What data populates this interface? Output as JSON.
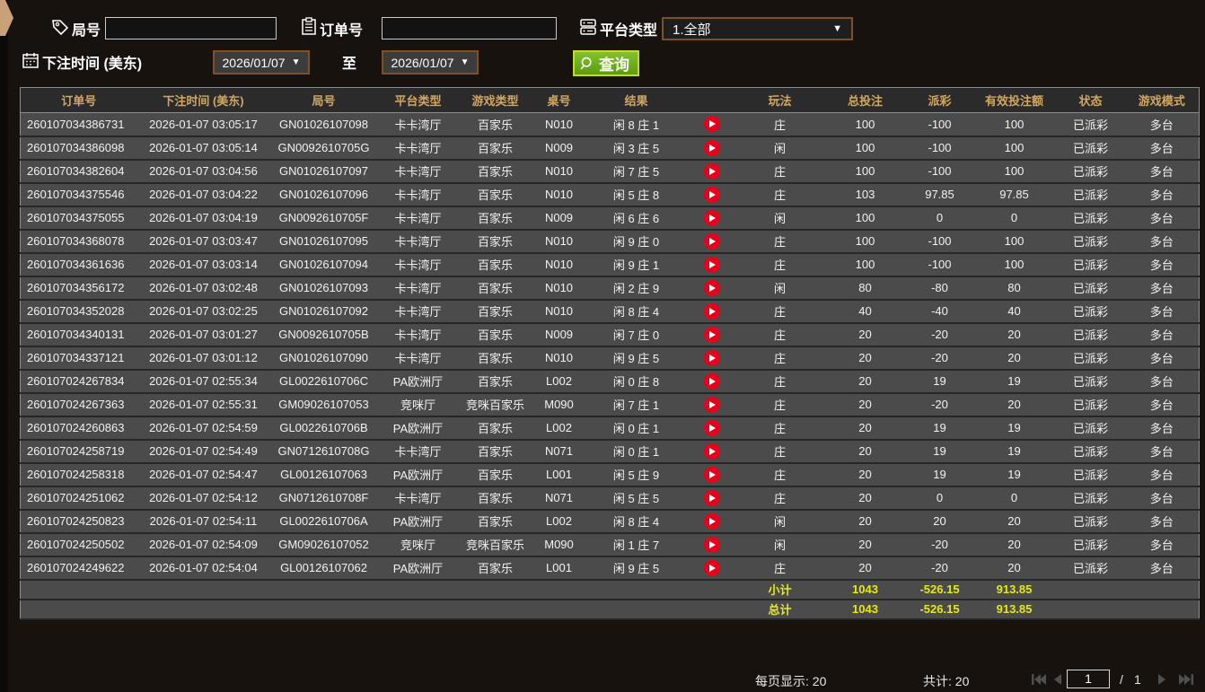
{
  "filters": {
    "game_no_label": "局号",
    "order_no_label": "订单号",
    "platform_label": "平台类型",
    "platform_value": "1.全部",
    "bet_time_label": "下注时间 (美东)",
    "date_from": "2026/01/07",
    "date_to": "2026/01/07",
    "to_label": "至",
    "search_label": "查询"
  },
  "table": {
    "columns": [
      "订单号",
      "下注时间 (美东)",
      "局号",
      "平台类型",
      "游戏类型",
      "桌号",
      "结果",
      "",
      "玩法",
      "总投注",
      "派彩",
      "有效投注额",
      "状态",
      "游戏模式"
    ],
    "rows": [
      {
        "order": "260107034386731",
        "time": "2026-01-07 03:05:17",
        "game_no": "GN01026107098",
        "platform": "卡卡湾厅",
        "game_type": "百家乐",
        "table_no": "N010",
        "result": "闲 8 庄 1",
        "play_type": "庄",
        "bet": "100",
        "payout": "-100",
        "valid": "100",
        "status": "已派彩",
        "mode": "多台"
      },
      {
        "order": "260107034386098",
        "time": "2026-01-07 03:05:14",
        "game_no": "GN0092610705G",
        "platform": "卡卡湾厅",
        "game_type": "百家乐",
        "table_no": "N009",
        "result": "闲 3 庄 5",
        "play_type": "闲",
        "bet": "100",
        "payout": "-100",
        "valid": "100",
        "status": "已派彩",
        "mode": "多台"
      },
      {
        "order": "260107034382604",
        "time": "2026-01-07 03:04:56",
        "game_no": "GN01026107097",
        "platform": "卡卡湾厅",
        "game_type": "百家乐",
        "table_no": "N010",
        "result": "闲 7 庄 5",
        "play_type": "庄",
        "bet": "100",
        "payout": "-100",
        "valid": "100",
        "status": "已派彩",
        "mode": "多台"
      },
      {
        "order": "260107034375546",
        "time": "2026-01-07 03:04:22",
        "game_no": "GN01026107096",
        "platform": "卡卡湾厅",
        "game_type": "百家乐",
        "table_no": "N010",
        "result": "闲 5 庄 8",
        "play_type": "庄",
        "bet": "103",
        "payout": "97.85",
        "valid": "97.85",
        "status": "已派彩",
        "mode": "多台"
      },
      {
        "order": "260107034375055",
        "time": "2026-01-07 03:04:19",
        "game_no": "GN0092610705F",
        "platform": "卡卡湾厅",
        "game_type": "百家乐",
        "table_no": "N009",
        "result": "闲 6 庄 6",
        "play_type": "闲",
        "bet": "100",
        "payout": "0",
        "valid": "0",
        "status": "已派彩",
        "mode": "多台"
      },
      {
        "order": "260107034368078",
        "time": "2026-01-07 03:03:47",
        "game_no": "GN01026107095",
        "platform": "卡卡湾厅",
        "game_type": "百家乐",
        "table_no": "N010",
        "result": "闲 9 庄 0",
        "play_type": "庄",
        "bet": "100",
        "payout": "-100",
        "valid": "100",
        "status": "已派彩",
        "mode": "多台"
      },
      {
        "order": "260107034361636",
        "time": "2026-01-07 03:03:14",
        "game_no": "GN01026107094",
        "platform": "卡卡湾厅",
        "game_type": "百家乐",
        "table_no": "N010",
        "result": "闲 9 庄 1",
        "play_type": "庄",
        "bet": "100",
        "payout": "-100",
        "valid": "100",
        "status": "已派彩",
        "mode": "多台"
      },
      {
        "order": "260107034356172",
        "time": "2026-01-07 03:02:48",
        "game_no": "GN01026107093",
        "platform": "卡卡湾厅",
        "game_type": "百家乐",
        "table_no": "N010",
        "result": "闲 2 庄 9",
        "play_type": "闲",
        "bet": "80",
        "payout": "-80",
        "valid": "80",
        "status": "已派彩",
        "mode": "多台"
      },
      {
        "order": "260107034352028",
        "time": "2026-01-07 03:02:25",
        "game_no": "GN01026107092",
        "platform": "卡卡湾厅",
        "game_type": "百家乐",
        "table_no": "N010",
        "result": "闲 8 庄 4",
        "play_type": "庄",
        "bet": "40",
        "payout": "-40",
        "valid": "40",
        "status": "已派彩",
        "mode": "多台"
      },
      {
        "order": "260107034340131",
        "time": "2026-01-07 03:01:27",
        "game_no": "GN0092610705B",
        "platform": "卡卡湾厅",
        "game_type": "百家乐",
        "table_no": "N009",
        "result": "闲 7 庄 0",
        "play_type": "庄",
        "bet": "20",
        "payout": "-20",
        "valid": "20",
        "status": "已派彩",
        "mode": "多台"
      },
      {
        "order": "260107034337121",
        "time": "2026-01-07 03:01:12",
        "game_no": "GN01026107090",
        "platform": "卡卡湾厅",
        "game_type": "百家乐",
        "table_no": "N010",
        "result": "闲 9 庄 5",
        "play_type": "庄",
        "bet": "20",
        "payout": "-20",
        "valid": "20",
        "status": "已派彩",
        "mode": "多台"
      },
      {
        "order": "260107024267834",
        "time": "2026-01-07 02:55:34",
        "game_no": "GL0022610706C",
        "platform": "PA欧洲厅",
        "game_type": "百家乐",
        "table_no": "L002",
        "result": "闲 0 庄 8",
        "play_type": "庄",
        "bet": "20",
        "payout": "19",
        "valid": "19",
        "status": "已派彩",
        "mode": "多台"
      },
      {
        "order": "260107024267363",
        "time": "2026-01-07 02:55:31",
        "game_no": "GM09026107053",
        "platform": "竞咪厅",
        "game_type": "竞咪百家乐",
        "table_no": "M090",
        "result": "闲 7 庄 1",
        "play_type": "庄",
        "bet": "20",
        "payout": "-20",
        "valid": "20",
        "status": "已派彩",
        "mode": "多台"
      },
      {
        "order": "260107024260863",
        "time": "2026-01-07 02:54:59",
        "game_no": "GL0022610706B",
        "platform": "PA欧洲厅",
        "game_type": "百家乐",
        "table_no": "L002",
        "result": "闲 0 庄 1",
        "play_type": "庄",
        "bet": "20",
        "payout": "19",
        "valid": "19",
        "status": "已派彩",
        "mode": "多台"
      },
      {
        "order": "260107024258719",
        "time": "2026-01-07 02:54:49",
        "game_no": "GN0712610708G",
        "platform": "卡卡湾厅",
        "game_type": "百家乐",
        "table_no": "N071",
        "result": "闲 0 庄 1",
        "play_type": "庄",
        "bet": "20",
        "payout": "19",
        "valid": "19",
        "status": "已派彩",
        "mode": "多台"
      },
      {
        "order": "260107024258318",
        "time": "2026-01-07 02:54:47",
        "game_no": "GL00126107063",
        "platform": "PA欧洲厅",
        "game_type": "百家乐",
        "table_no": "L001",
        "result": "闲 5 庄 9",
        "play_type": "庄",
        "bet": "20",
        "payout": "19",
        "valid": "19",
        "status": "已派彩",
        "mode": "多台"
      },
      {
        "order": "260107024251062",
        "time": "2026-01-07 02:54:12",
        "game_no": "GN0712610708F",
        "platform": "卡卡湾厅",
        "game_type": "百家乐",
        "table_no": "N071",
        "result": "闲 5 庄 5",
        "play_type": "庄",
        "bet": "20",
        "payout": "0",
        "valid": "0",
        "status": "已派彩",
        "mode": "多台"
      },
      {
        "order": "260107024250823",
        "time": "2026-01-07 02:54:11",
        "game_no": "GL0022610706A",
        "platform": "PA欧洲厅",
        "game_type": "百家乐",
        "table_no": "L002",
        "result": "闲 8 庄 4",
        "play_type": "闲",
        "bet": "20",
        "payout": "20",
        "valid": "20",
        "status": "已派彩",
        "mode": "多台"
      },
      {
        "order": "260107024250502",
        "time": "2026-01-07 02:54:09",
        "game_no": "GM09026107052",
        "platform": "竞咪厅",
        "game_type": "竞咪百家乐",
        "table_no": "M090",
        "result": "闲 1 庄 7",
        "play_type": "闲",
        "bet": "20",
        "payout": "-20",
        "valid": "20",
        "status": "已派彩",
        "mode": "多台"
      },
      {
        "order": "260107024249622",
        "time": "2026-01-07 02:54:04",
        "game_no": "GL00126107062",
        "platform": "PA欧洲厅",
        "game_type": "百家乐",
        "table_no": "L001",
        "result": "闲 9 庄 5",
        "play_type": "庄",
        "bet": "20",
        "payout": "-20",
        "valid": "20",
        "status": "已派彩",
        "mode": "多台"
      }
    ],
    "subtotal": {
      "label": "小计",
      "bet": "1043",
      "payout": "-526.15",
      "valid": "913.85"
    },
    "total": {
      "label": "总计",
      "bet": "1043",
      "payout": "-526.15",
      "valid": "913.85"
    }
  },
  "pagination": {
    "per_page_label": "每页显示:",
    "per_page": "20",
    "total_label": "共计:",
    "total": "20",
    "page": "1",
    "separator": "/",
    "pages": "1"
  },
  "colors": {
    "win_red": "#c6112d",
    "loss_green": "#4ae321",
    "status_green": "#35dd35",
    "summary_yellow": "#e7e916",
    "header_gold": "#d2a761"
  }
}
